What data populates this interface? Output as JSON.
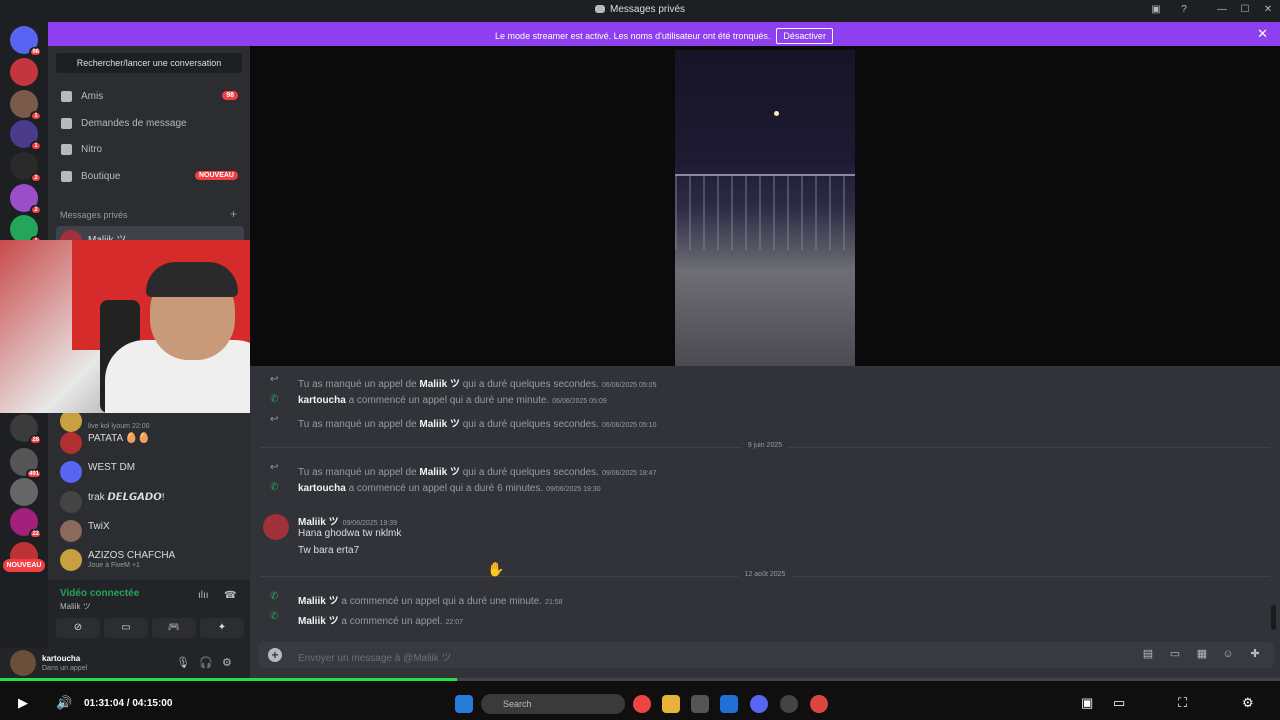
{
  "window": {
    "title": "Messages privés"
  },
  "banner": {
    "text": "Le mode streamer est activé. Les noms d'utilisateur ont été tronqués.",
    "button": "Désactiver"
  },
  "servers": [
    {
      "icon": "discord-home-icon",
      "badge": "98",
      "color": "#5865f2"
    },
    {
      "icon": "server-avatar-icon",
      "badge": "",
      "color": "#c4363d"
    },
    {
      "icon": "server-avatar-icon",
      "badge": "1",
      "color": "#7a5a4a"
    },
    {
      "icon": "server-avatar-icon",
      "badge": "1",
      "color": "#4a3a8a"
    },
    {
      "icon": "question-server-icon",
      "badge": "2",
      "color": "#2a2a2a"
    },
    {
      "icon": "group-icon",
      "badge": "2",
      "color": "#9b4ec9"
    },
    {
      "icon": "group-icon",
      "badge": "1",
      "color": "#23a55a"
    },
    {
      "icon": "server-avatar-icon",
      "badge": "28",
      "color": "#3a3a3a"
    },
    {
      "icon": "server-avatar-icon",
      "badge": "491",
      "color": "#555"
    },
    {
      "icon": "server-avatar-icon",
      "badge": "",
      "color": "#666"
    },
    {
      "icon": "server-avatar-icon",
      "badge": "22",
      "color": "#a0207a"
    },
    {
      "icon": "server-avatar-icon",
      "badge": "",
      "color": "#b33"
    }
  ],
  "new_badge": "NOUVEAU",
  "sidebar": {
    "search": "Rechercher/lancer une conversation",
    "nav": [
      {
        "label": "Amis",
        "pill": "98",
        "icon": "friends-icon"
      },
      {
        "label": "Demandes de message",
        "pill": "",
        "icon": "mail-icon"
      },
      {
        "label": "Nitro",
        "pill": "",
        "icon": "nitro-icon"
      },
      {
        "label": "Boutique",
        "pill": "NOUVEAU",
        "icon": "shop-icon"
      }
    ],
    "dm_header": "Messages privés",
    "dms": [
      {
        "name": "Maliik ツ",
        "sub": "",
        "color": "#a0303a"
      },
      {
        "name": "",
        "sub": "live kol lyoum 22:00",
        "color": "#c9a040"
      },
      {
        "name": "PATATA 🥚🥚",
        "sub": "",
        "color": "#b03030"
      },
      {
        "name": "WEST DM",
        "sub": "",
        "color": "#5865f2"
      },
      {
        "name": "trak 𝘿𝙀𝙇𝙂𝘼𝘿𝙊!",
        "sub": "",
        "color": "#444"
      },
      {
        "name": "TwiX",
        "sub": "",
        "color": "#8a6a5a"
      },
      {
        "name": "AZIZOS CHAFCHA",
        "sub": "Joue à FiveM +1",
        "color": "#c9a040"
      }
    ]
  },
  "voice": {
    "status": "Vidéo connectée",
    "channel": "Maliik ツ"
  },
  "user": {
    "name": "kartoucha",
    "status": "Dans un appel"
  },
  "chat": {
    "events": [
      {
        "pre": "Tu as manqué un appel de ",
        "user": "Maliik ツ",
        "post": " qui a duré quelques secondes.",
        "ts": "06/06/2025 05:05",
        "kind": "missed"
      },
      {
        "pre": "",
        "user": "kartoucha",
        "post": " a commencé un appel qui a duré une minute.",
        "ts": "06/06/2025 05:09",
        "kind": "call"
      },
      {
        "pre": "Tu as manqué un appel de ",
        "user": "Maliik ツ",
        "post": " qui a duré quelques secondes.",
        "ts": "06/06/2025 05:10",
        "kind": "missed"
      }
    ],
    "date1": "9 juin 2025",
    "events2": [
      {
        "pre": "Tu as manqué un appel de ",
        "user": "Maliik ツ",
        "post": " qui a duré quelques secondes.",
        "ts": "09/06/2025 18:47",
        "kind": "missed"
      },
      {
        "pre": "",
        "user": "kartoucha",
        "post": " a commencé un appel qui a duré 6 minutes.",
        "ts": "09/06/2025 19:30",
        "kind": "call"
      }
    ],
    "message": {
      "author": "Maliik ツ",
      "ts": "09/06/2025 19:39",
      "lines": [
        "Hana ghodwa tw nklmk",
        "Tw bara erta7"
      ]
    },
    "date2": "12 août 2025",
    "events3": [
      {
        "pre": "",
        "user": "Maliik ツ",
        "post": " a commencé un appel qui a duré une minute.",
        "ts": "21:58",
        "kind": "call"
      },
      {
        "pre": "",
        "user": "Maliik ツ",
        "post": " a commencé un appel.",
        "ts": "22:07",
        "kind": "call"
      }
    ],
    "composer_placeholder": "Envoyer un message à @Maliik ツ"
  },
  "player": {
    "time": "01:31:04 / 04:15:00",
    "progress": 0.357
  },
  "taskbar": {
    "search": "Search"
  },
  "colors": {
    "accent": "#5865f2",
    "banner": "#8e3ff0",
    "green": "#23a55a",
    "red": "#f23f43"
  }
}
